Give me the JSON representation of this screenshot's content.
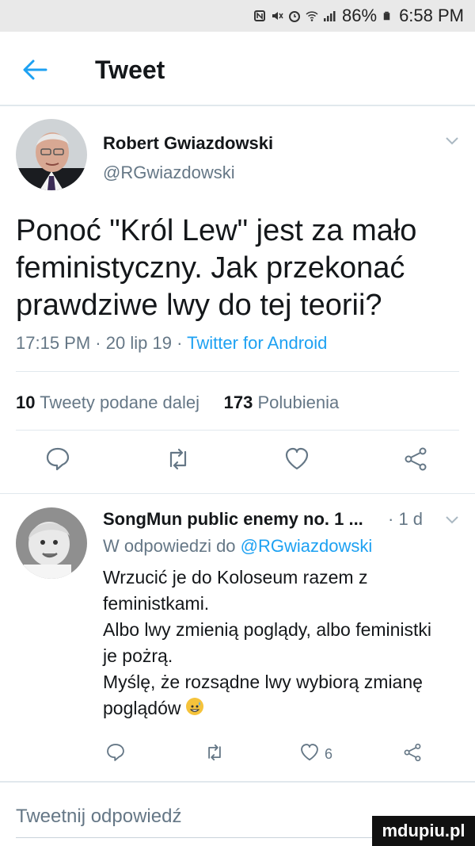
{
  "status_bar": {
    "battery_percent": "86%",
    "time": "6:58 PM",
    "icons": [
      "nfc-icon",
      "mute-icon",
      "alarm-icon",
      "wifi-icon",
      "signal-icon",
      "battery-icon"
    ]
  },
  "header": {
    "title": "Tweet",
    "back_icon": "arrow-left-icon"
  },
  "tweet": {
    "author_name": "Robert Gwiazdowski",
    "author_handle": "@RGwiazdowski",
    "text_lines": [
      "Ponoć \"Król Lew\" jest za mało",
      "feministyczny. Jak przekonać",
      "prawdziwe lwy do tej teorii?"
    ],
    "time": "17:15 PM",
    "date": "20 lip 19",
    "source": "Twitter for Android",
    "retweets_count": "10",
    "retweets_label": "Tweety podane dalej",
    "likes_count": "173",
    "likes_label": "Polubienia"
  },
  "reply": {
    "author_name": "SongMun public enemy no. 1 ...",
    "time": "· 1 d",
    "reply_prefix": "W odpowiedzi do",
    "reply_mention": "@RGwiazdowski",
    "lines": [
      "Wrzucić je do Koloseum razem z",
      "feministkami.",
      "Albo lwy zmienią poglądy, albo feministki",
      "je pożrą.",
      "Myślę, że rozsądne lwy wybiorą zmianę",
      "poglądów"
    ],
    "like_count": "6"
  },
  "compose": {
    "placeholder": "Tweetnij odpowiedź"
  },
  "watermark": "mdupiu.pl",
  "colors": {
    "accent": "#1da1f2",
    "secondary_text": "#657786",
    "divider": "#e1e8ed"
  }
}
